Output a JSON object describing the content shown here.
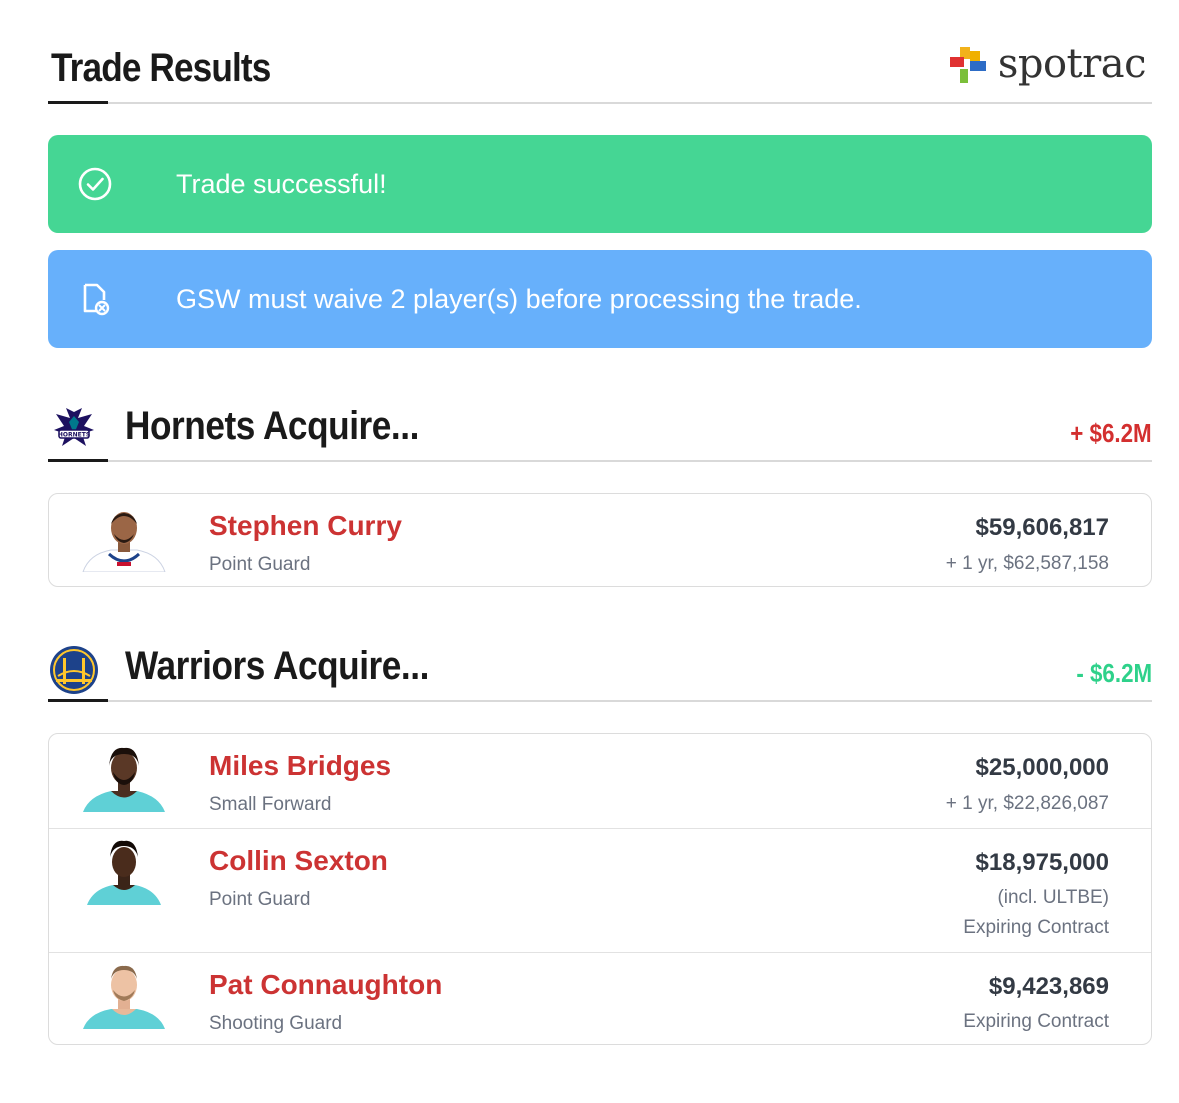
{
  "page": {
    "title": "Trade Results",
    "brand": "spotrac"
  },
  "alerts": {
    "success": {
      "text": "Trade successful!",
      "icon": "check-circle-icon",
      "color": "#45d694"
    },
    "info": {
      "text": "GSW must waive 2 player(s) before processing the trade.",
      "icon": "document-x-icon",
      "color": "#67b0fb"
    }
  },
  "sections": [
    {
      "title": "Hornets Acquire...",
      "delta": "+ $6.2M",
      "delta_color": "#d32f2f",
      "team_icon": "hornets-logo",
      "players": [
        {
          "name": "Stephen Curry",
          "position": "Point Guard",
          "salary": "$59,606,817",
          "notes": [
            "+ 1 yr, $62,587,158"
          ],
          "jersey": "#ffffff"
        }
      ]
    },
    {
      "title": "Warriors Acquire...",
      "delta": "- $6.2M",
      "delta_color": "#2ed18a",
      "team_icon": "warriors-logo",
      "players": [
        {
          "name": "Miles Bridges",
          "position": "Small Forward",
          "salary": "$25,000,000",
          "notes": [
            "+ 1 yr, $22,826,087"
          ],
          "jersey": "#5fd0d6"
        },
        {
          "name": "Collin Sexton",
          "position": "Point Guard",
          "salary": "$18,975,000",
          "notes": [
            "(incl. ULTBE)",
            "Expiring Contract"
          ],
          "jersey": "#5fd0d6"
        },
        {
          "name": "Pat Connaughton",
          "position": "Shooting Guard",
          "salary": "$9,423,869",
          "notes": [
            "Expiring Contract"
          ],
          "jersey": "#5fd0d6"
        }
      ]
    }
  ],
  "colors": {
    "player_name": "#cc3333",
    "accent_rule": "#1a1a1a"
  }
}
